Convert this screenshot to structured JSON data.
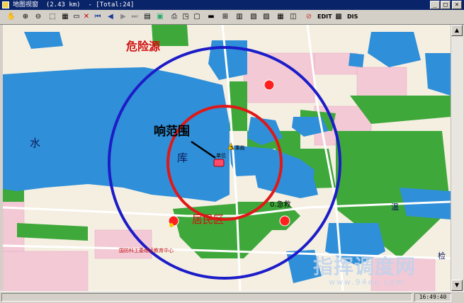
{
  "window": {
    "title": "地图视窗  (2.43 km)  - [Total:24]"
  },
  "toolbar": {
    "edit_label": "EDIT",
    "dis_label": "DIS"
  },
  "map": {
    "labels": {
      "hazard_source": "危险源",
      "impact_range": "响范围",
      "water": "水",
      "reservoir": "库",
      "residential": "居民区",
      "rescue": "0.急救",
      "accident": "5.事故",
      "unit": "单位",
      "institute": "国防科工委继续教育中心",
      "right_edge_1": "温",
      "right_edge_2": "检"
    },
    "colors": {
      "outer_circle": "#1c1cc8",
      "inner_circle": "#e01818",
      "water": "#2f8fd8",
      "green": "#3fa83a",
      "land": "#f5efe2",
      "residential_pink": "#f3c9d6",
      "marker": "#ff1f1f"
    },
    "watermark": "指挥调度网",
    "watermark_url": "www.94ec.com"
  },
  "statusbar": {
    "time": "16:49:40"
  }
}
